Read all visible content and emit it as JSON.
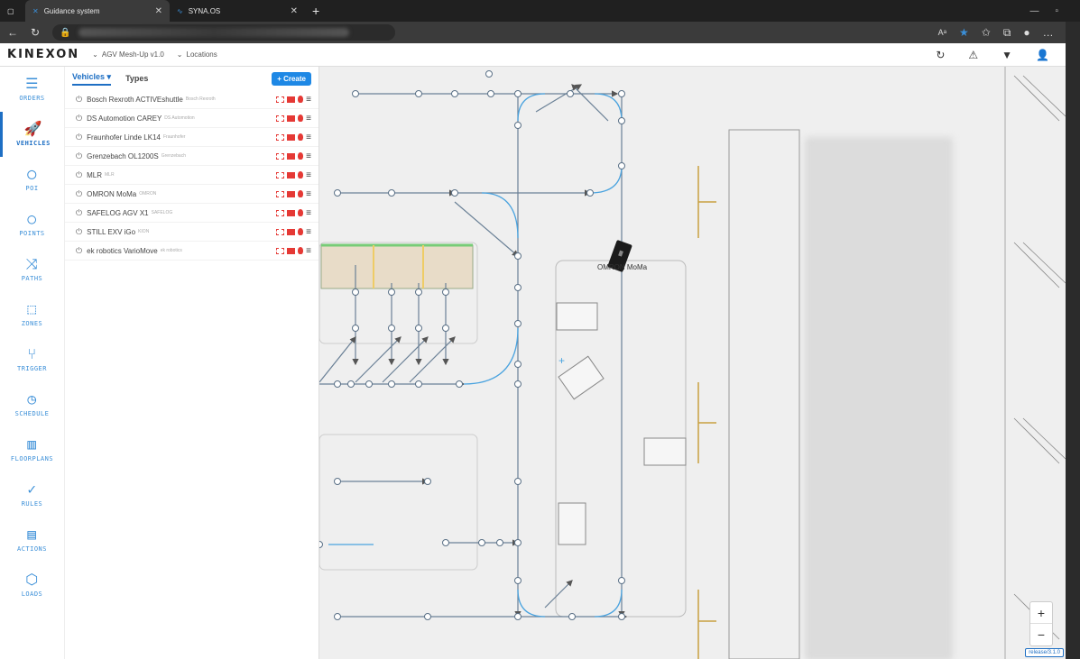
{
  "browser": {
    "tabs": [
      {
        "title": "Guidance system",
        "active": true
      },
      {
        "title": "SYNA.OS",
        "active": false
      }
    ],
    "new_tab": "+"
  },
  "header": {
    "logo": "KINEXON",
    "project": "AGV Mesh-Up v1.0",
    "locations": "Locations"
  },
  "nav": [
    {
      "label": "ORDERS",
      "icon": "orders-icon",
      "glyph": "☰"
    },
    {
      "label": "VEHICLES",
      "icon": "rocket-icon",
      "glyph": "🚀",
      "active": true
    },
    {
      "label": "POI",
      "icon": "pin-icon",
      "glyph": "◯"
    },
    {
      "label": "POINTS",
      "icon": "circle-icon",
      "glyph": "○"
    },
    {
      "label": "PATHS",
      "icon": "paths-icon",
      "glyph": "⤨"
    },
    {
      "label": "ZONES",
      "icon": "zones-icon",
      "glyph": "⬚"
    },
    {
      "label": "TRIGGER",
      "icon": "trigger-icon",
      "glyph": "⑂"
    },
    {
      "label": "SCHEDULE",
      "icon": "clock-icon",
      "glyph": "◷"
    },
    {
      "label": "FLOORPLANS",
      "icon": "map-icon",
      "glyph": "▥"
    },
    {
      "label": "RULES",
      "icon": "check-icon",
      "glyph": "✓"
    },
    {
      "label": "ACTIONS",
      "icon": "clipboard-icon",
      "glyph": "▤"
    },
    {
      "label": "LOADS",
      "icon": "box-icon",
      "glyph": "⬡"
    }
  ],
  "panel": {
    "tab_vehicles": "Vehicles",
    "tab_types": "Types",
    "create": "Create",
    "vehicles": [
      {
        "name": "Bosch Rexroth ACTIVEshuttle",
        "sub": "Bosch Rexroth"
      },
      {
        "name": "DS Automotion CAREY",
        "sub": "DS Automotion"
      },
      {
        "name": "Fraunhofer Linde LK14",
        "sub": "Fraunhofer"
      },
      {
        "name": "Grenzebach OL1200S",
        "sub": "Grenzebach"
      },
      {
        "name": "MLR",
        "sub": "MLR"
      },
      {
        "name": "OMRON MoMa",
        "sub": "OMRON"
      },
      {
        "name": "SAFELOG AGV X1",
        "sub": "SAFELOG"
      },
      {
        "name": "STILL EXV iGo",
        "sub": "KION"
      },
      {
        "name": "ek robotics VarioMove",
        "sub": "ek robotics"
      }
    ]
  },
  "map": {
    "vehicle_label": "OMRON MoMa",
    "zoom_in": "+",
    "zoom_out": "−",
    "release": "release/3.1.0"
  }
}
